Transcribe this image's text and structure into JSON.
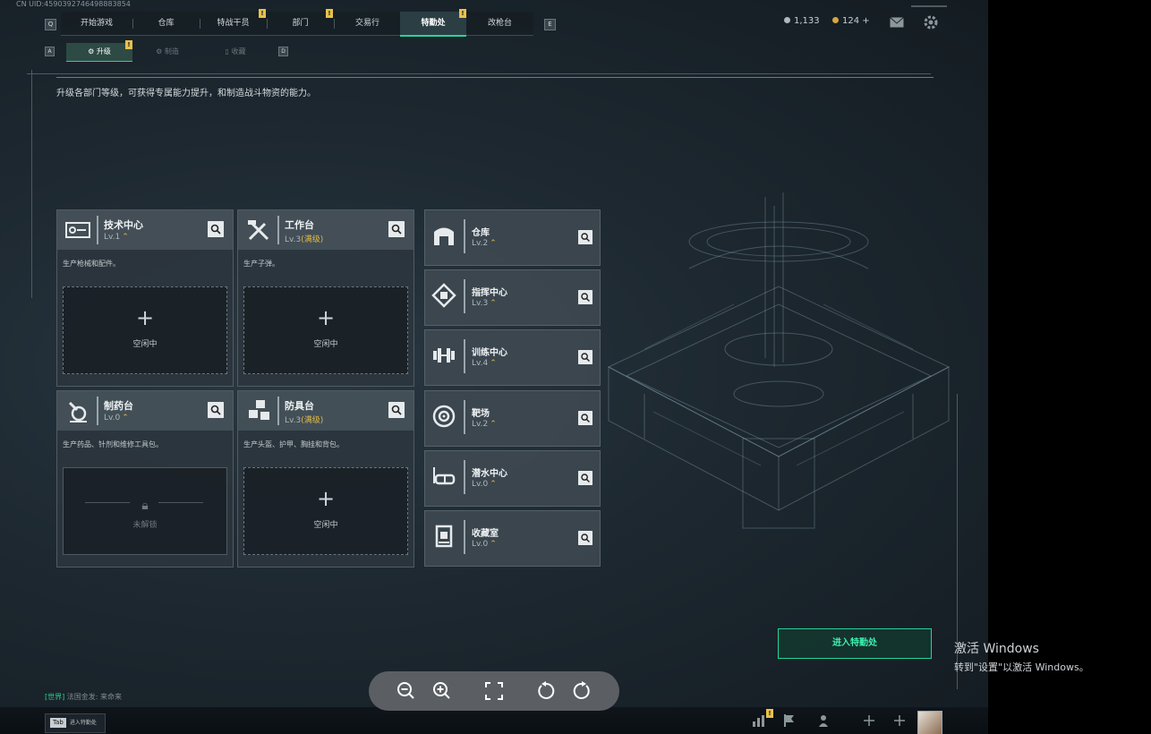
{
  "uid": "CN UID:4590392746498883854",
  "nav": {
    "key_left": "Q",
    "key_right": "E",
    "items": [
      {
        "label": "开始游戏"
      },
      {
        "label": "仓库"
      },
      {
        "label": "特战干员"
      },
      {
        "label": "部门"
      },
      {
        "label": "交易行"
      },
      {
        "label": "特勤处"
      },
      {
        "label": "改枪台"
      }
    ],
    "badge": "!"
  },
  "resources": {
    "gems": "1,133",
    "coins": "124 +"
  },
  "subnav": {
    "key_left": "A",
    "key_right": "D",
    "items": [
      {
        "label": "升级"
      },
      {
        "label": "制造"
      },
      {
        "label": "收藏"
      }
    ]
  },
  "description": "升级各部门等级，可获得专属能力提升，和制造战斗物资的能力。",
  "big_cards": [
    {
      "name": "技术中心",
      "level": "Lv.1",
      "max": "",
      "sub": "生产枪械和配件。",
      "slot": "空闲中",
      "icon": "tech-center-icon"
    },
    {
      "name": "工作台",
      "level": "Lv.3",
      "max": "(满级)",
      "sub": "生产子弹。",
      "slot": "空闲中",
      "icon": "workbench-icon"
    },
    {
      "name": "制药台",
      "level": "Lv.0",
      "max": "",
      "sub": "生产药品、针剂和维修工具包。",
      "slot": "未解锁",
      "icon": "pharmacy-icon"
    },
    {
      "name": "防具台",
      "level": "Lv.3",
      "max": "(满级)",
      "sub": "生产头盔、护甲、胸挂和背包。",
      "slot": "空闲中",
      "icon": "armor-bench-icon"
    }
  ],
  "small_cards": [
    {
      "name": "仓库",
      "level": "Lv.2",
      "icon": "warehouse-icon"
    },
    {
      "name": "指挥中心",
      "level": "Lv.3",
      "icon": "command-center-icon"
    },
    {
      "name": "训练中心",
      "level": "Lv.4",
      "icon": "training-center-icon"
    },
    {
      "name": "靶场",
      "level": "Lv.2",
      "icon": "shooting-range-icon"
    },
    {
      "name": "潜水中心",
      "level": "Lv.0",
      "icon": "diving-center-icon"
    },
    {
      "name": "收藏室",
      "level": "Lv.0",
      "icon": "collection-room-icon"
    }
  ],
  "enter_button": "进入特勤处",
  "chat": {
    "channel": "[世界]",
    "message": "法国金发: 来命来"
  },
  "tab_hint": {
    "key": "Tab",
    "label": "进入特勤处"
  },
  "bottom_badge": "!",
  "watermark": {
    "line1": "激活 Windows",
    "line2": "转到\"设置\"以激活 Windows。"
  },
  "colors": {
    "accent": "#27d39a",
    "max_level": "#e0b94a",
    "badge": "#e8c14a"
  }
}
